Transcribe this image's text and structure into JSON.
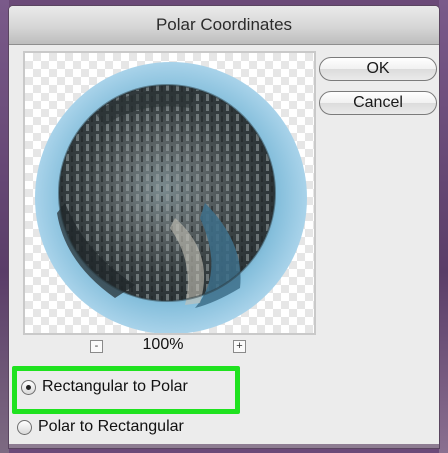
{
  "dialog": {
    "title": "Polar Coordinates",
    "ok_label": "OK",
    "cancel_label": "Cancel"
  },
  "zoom": {
    "minus_label": "-",
    "plus_label": "+",
    "value": "100%"
  },
  "conversion": {
    "options": [
      {
        "label": "Rectangular to Polar",
        "selected": true
      },
      {
        "label": "Polar to Rectangular",
        "selected": false
      }
    ]
  },
  "colors": {
    "highlight": "#1fe21f",
    "sky": "#7fb6d8",
    "water": "#3f6f86"
  }
}
